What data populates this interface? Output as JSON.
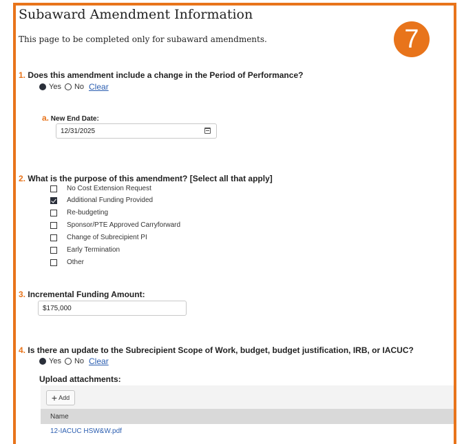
{
  "page": {
    "title": "Subaward Amendment Information",
    "subtitle": "This page to be completed only for subaward amendments.",
    "step_badge": "7",
    "accent_color": "#e8741b"
  },
  "q1": {
    "number": "1.",
    "text": "Does this amendment include a change in the Period of Performance?",
    "options": [
      "Yes",
      "No"
    ],
    "selected": "Yes",
    "clear_label": "Clear",
    "sub": {
      "number": "a.",
      "label": "New End Date:",
      "value": "12/31/2025",
      "icon": "calendar-icon"
    }
  },
  "q2": {
    "number": "2.",
    "text": "What is the purpose of this amendment? [Select all that apply]",
    "options": [
      {
        "label": "No Cost Extension Request",
        "checked": false
      },
      {
        "label": "Additional Funding Provided",
        "checked": true
      },
      {
        "label": "Re-budgeting",
        "checked": false
      },
      {
        "label": "Sponsor/PTE Approved Carryforward",
        "checked": false
      },
      {
        "label": "Change of Subrecipient PI",
        "checked": false
      },
      {
        "label": "Early Termination",
        "checked": false
      },
      {
        "label": "Other",
        "checked": false
      }
    ]
  },
  "q3": {
    "number": "3.",
    "text": "Incremental Funding Amount:",
    "value": "$175,000"
  },
  "q4": {
    "number": "4.",
    "text": "Is there an update to the Subrecipient Scope of Work, budget, budget justification, IRB, or IACUC?",
    "options": [
      "Yes",
      "No"
    ],
    "selected": "Yes",
    "clear_label": "Clear"
  },
  "attachments": {
    "label": "Upload attachments:",
    "add_label": "Add",
    "column_header": "Name",
    "files": [
      "12-IACUC HSW&W.pdf"
    ]
  }
}
